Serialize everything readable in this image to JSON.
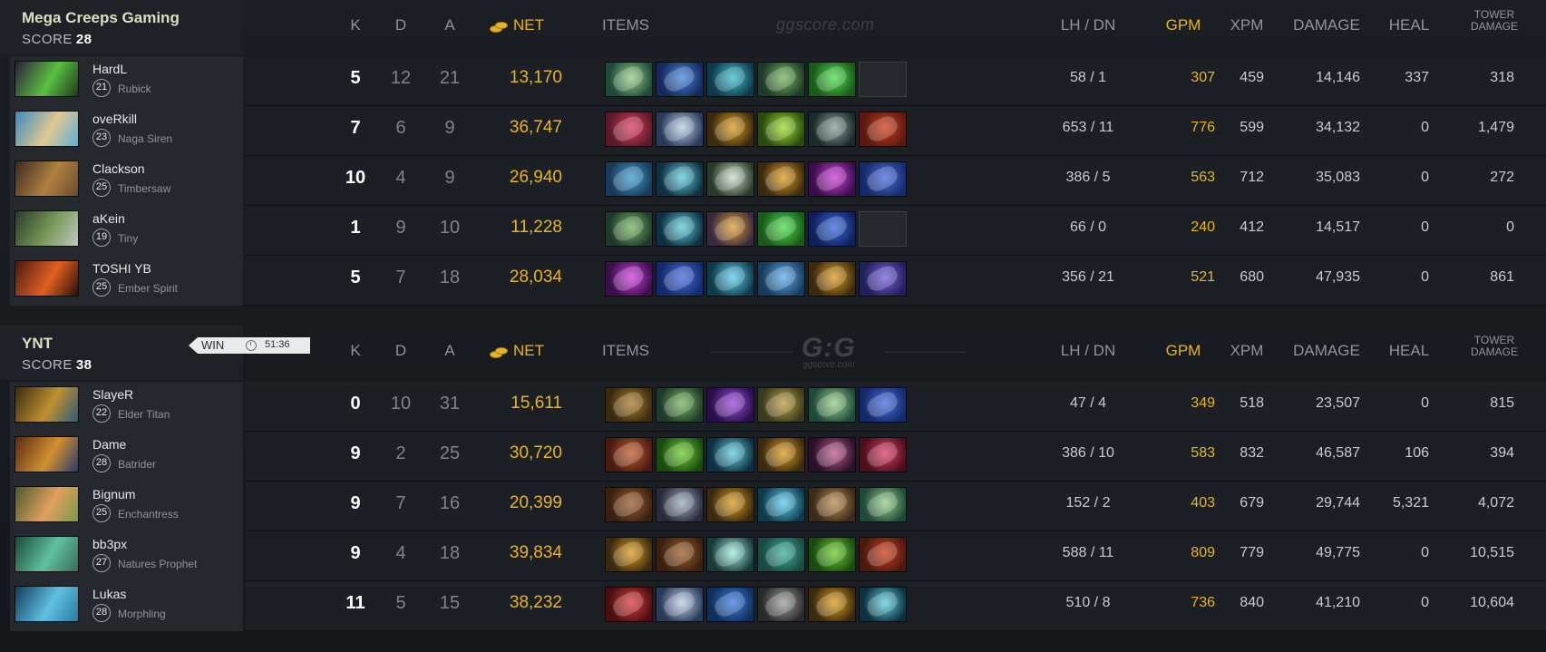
{
  "headers": {
    "k": "K",
    "d": "D",
    "a": "A",
    "net": "NET",
    "items": "ITEMS",
    "lh_dn": "LH  /  DN",
    "gpm": "GPM",
    "xpm": "XPM",
    "damage": "DAMAGE",
    "heal": "HEAL",
    "tower_line1": "TOWER",
    "tower_line2": "DAMAGE"
  },
  "watermark": {
    "site": "ggscore.com",
    "logo": "G:G"
  },
  "colors": {
    "gold": "#e5b42c",
    "background": "#16191c",
    "player_card": "#25292e",
    "row": "#1c2024"
  },
  "teams": [
    {
      "name": "Mega Creeps Gaming",
      "score_label": "SCORE",
      "score": "28",
      "players": [
        {
          "name": "HardL",
          "level": "21",
          "hero": "Rubick",
          "k": "5",
          "d": "12",
          "a": "21",
          "net": "13,170",
          "lh_dn": "58  /  1",
          "gpm": "307",
          "xpm": "459",
          "damage": "14,146",
          "heal": "337",
          "tower": "318",
          "portrait": [
            "#2a1f3a",
            "#5ac040",
            "#1a3a1a"
          ],
          "items": [
            [
              "#1f4a3a",
              "#9ad08a"
            ],
            [
              "#152a5a",
              "#4a88e0"
            ],
            [
              "#0f3a4a",
              "#40c0d0"
            ],
            [
              "#1f3a2a",
              "#7ab860"
            ],
            [
              "#1a5a1a",
              "#50e050"
            ],
            null
          ]
        },
        {
          "name": "oveRkill",
          "level": "23",
          "hero": "Naga Siren",
          "k": "7",
          "d": "6",
          "a": "9",
          "net": "36,747",
          "lh_dn": "653  /  11",
          "gpm": "776",
          "xpm": "599",
          "damage": "34,132",
          "heal": "0",
          "tower": "1,479",
          "portrait": [
            "#3a8ac0",
            "#e0c890",
            "#5ab0d8"
          ],
          "items": [
            [
              "#5a1a2a",
              "#e04060"
            ],
            [
              "#2a3a5a",
              "#c0d0e8"
            ],
            [
              "#3a2a10",
              "#e0a020"
            ],
            [
              "#2a4a10",
              "#a0e030"
            ],
            [
              "#1a2a2a",
              "#90a0a0"
            ],
            [
              "#5a1a10",
              "#d04020"
            ]
          ]
        },
        {
          "name": "Clackson",
          "level": "25",
          "hero": "Timbersaw",
          "k": "10",
          "d": "4",
          "a": "9",
          "net": "26,940",
          "lh_dn": "386  /  5",
          "gpm": "563",
          "xpm": "712",
          "damage": "35,083",
          "heal": "0",
          "tower": "272",
          "portrait": [
            "#3a2a20",
            "#b08040",
            "#6a4a30"
          ],
          "items": [
            [
              "#1a3a5a",
              "#40a0d0"
            ],
            [
              "#0f3040",
              "#60d0e0"
            ],
            [
              "#2a3a2a",
              "#d0e0d0"
            ],
            [
              "#3a2a10",
              "#e0a020"
            ],
            [
              "#3a0f4a",
              "#d040e0"
            ],
            [
              "#152a6a",
              "#4a70e0"
            ]
          ]
        },
        {
          "name": "aKein",
          "level": "19",
          "hero": "Tiny",
          "k": "1",
          "d": "9",
          "a": "10",
          "net": "11,228",
          "lh_dn": "66  /  0",
          "gpm": "240",
          "xpm": "412",
          "damage": "14,517",
          "heal": "0",
          "tower": "0",
          "portrait": [
            "#2a3a2a",
            "#7a9a5a",
            "#c0c8c0"
          ],
          "items": [
            [
              "#1f3a2a",
              "#7ab860"
            ],
            [
              "#0f3040",
              "#60d0e0"
            ],
            [
              "#3a2a40",
              "#e0a030"
            ],
            [
              "#1a5a1a",
              "#50e050"
            ],
            [
              "#10205a",
              "#3a70e0"
            ],
            null
          ]
        },
        {
          "name": "TOSHI YB",
          "level": "25",
          "hero": "Ember Spirit",
          "k": "5",
          "d": "7",
          "a": "18",
          "net": "28,034",
          "lh_dn": "356  /  21",
          "gpm": "521",
          "xpm": "680",
          "damage": "47,935",
          "heal": "0",
          "tower": "861",
          "portrait": [
            "#4a1a10",
            "#e06020",
            "#2a0f0a"
          ],
          "items": [
            [
              "#3a0f4a",
              "#d040e0"
            ],
            [
              "#152a6a",
              "#4a70e0"
            ],
            [
              "#0f3a4a",
              "#60d0f0"
            ],
            [
              "#1a3a5a",
              "#60b0f0"
            ],
            [
              "#3a2a10",
              "#e0a020"
            ],
            [
              "#20205a",
              "#7a60e0"
            ]
          ]
        }
      ]
    },
    {
      "name": "YNT",
      "score_label": "SCORE",
      "score": "38",
      "result": "WIN",
      "duration": "51:36",
      "players": [
        {
          "name": "SlayeR",
          "level": "22",
          "hero": "Elder Titan",
          "k": "0",
          "d": "10",
          "a": "31",
          "net": "15,611",
          "lh_dn": "47  /  4",
          "gpm": "349",
          "xpm": "518",
          "damage": "23,507",
          "heal": "0",
          "tower": "815",
          "portrait": [
            "#3a2a10",
            "#c09030",
            "#2a5a7a"
          ],
          "items": [
            [
              "#3a2a10",
              "#b08030"
            ],
            [
              "#1f3a2a",
              "#7ab860"
            ],
            [
              "#2a104a",
              "#a050e0"
            ],
            [
              "#3a3a20",
              "#c0a040"
            ],
            [
              "#1f4a3a",
              "#9ad08a"
            ],
            [
              "#152a6a",
              "#4a70e0"
            ]
          ]
        },
        {
          "name": "Dame",
          "level": "28",
          "hero": "Batrider",
          "k": "9",
          "d": "2",
          "a": "25",
          "net": "30,720",
          "lh_dn": "386  /  10",
          "gpm": "583",
          "xpm": "832",
          "damage": "46,587",
          "heal": "106",
          "tower": "394",
          "portrait": [
            "#5a2a10",
            "#d09030",
            "#2a3a6a"
          ],
          "items": [
            [
              "#4a1a10",
              "#c06030"
            ],
            [
              "#1a4a10",
              "#70d030"
            ],
            [
              "#0f3040",
              "#60d0e0"
            ],
            [
              "#3a2a10",
              "#e0a020"
            ],
            [
              "#2a102a",
              "#c06090"
            ],
            [
              "#4a0f1a",
              "#e04070"
            ]
          ]
        },
        {
          "name": "Bignum",
          "level": "25",
          "hero": "Enchantress",
          "k": "9",
          "d": "7",
          "a": "16",
          "net": "20,399",
          "lh_dn": "152  /  2",
          "gpm": "403",
          "xpm": "679",
          "damage": "29,744",
          "heal": "5,321",
          "tower": "4,072",
          "portrait": [
            "#4a5a2a",
            "#e0a060",
            "#7a9a4a"
          ],
          "items": [
            [
              "#3a2010",
              "#a06030"
            ],
            [
              "#2a2a3a",
              "#a0b0c0"
            ],
            [
              "#3a2a10",
              "#e0a020"
            ],
            [
              "#0f3a4a",
              "#60d0f0"
            ],
            [
              "#3a2a1a",
              "#c09050"
            ],
            [
              "#1f4a3a",
              "#9ad08a"
            ]
          ]
        },
        {
          "name": "bb3px",
          "level": "27",
          "hero": "Natures Prophet",
          "k": "9",
          "d": "4",
          "a": "18",
          "net": "39,834",
          "lh_dn": "588  /  11",
          "gpm": "809",
          "xpm": "779",
          "damage": "49,775",
          "heal": "0",
          "tower": "10,515",
          "portrait": [
            "#1a4a3a",
            "#60c0a0",
            "#3a6a5a"
          ],
          "items": [
            [
              "#3a2a10",
              "#e0a020"
            ],
            [
              "#3a2010",
              "#a06030"
            ],
            [
              "#1a3a3a",
              "#a0f0e0"
            ],
            [
              "#1a4a40",
              "#40b0a0"
            ],
            [
              "#1a4a10",
              "#70d030"
            ],
            [
              "#4a1a10",
              "#d04020"
            ]
          ]
        },
        {
          "name": "Lukas",
          "level": "28",
          "hero": "Morphling",
          "k": "11",
          "d": "5",
          "a": "15",
          "net": "38,232",
          "lh_dn": "510  /  8",
          "gpm": "736",
          "xpm": "840",
          "damage": "41,210",
          "heal": "0",
          "tower": "10,604",
          "portrait": [
            "#0f3a5a",
            "#60c0e0",
            "#2a7aa0"
          ],
          "items": [
            [
              "#4a0f10",
              "#e04040"
            ],
            [
              "#2a3a5a",
              "#c0d0e8"
            ],
            [
              "#10305a",
              "#4080e0"
            ],
            [
              "#2a2a2a",
              "#a0a0a0"
            ],
            [
              "#3a2a10",
              "#e0a020"
            ],
            [
              "#0f3040",
              "#60d0e0"
            ]
          ]
        }
      ]
    }
  ]
}
